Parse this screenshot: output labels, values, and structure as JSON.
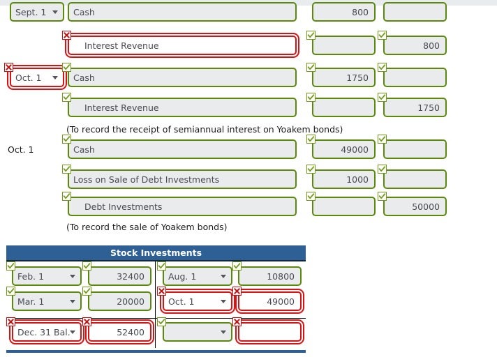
{
  "journal": {
    "rows": [
      {
        "date": "Sept. 1",
        "date_state": "ok",
        "date_marker": "none",
        "account": "Cash",
        "account_state": "ok",
        "account_marker": "none",
        "account_indent": false,
        "debit": "800",
        "debit_state": "ok",
        "debit_marker": "none",
        "credit": "",
        "credit_state": "ok",
        "credit_marker": "none"
      },
      {
        "date": "",
        "date_state": "none",
        "date_marker": "none",
        "account": "Interest Revenue",
        "account_state": "bad",
        "account_marker": "bad",
        "account_indent": true,
        "debit": "",
        "debit_state": "ok",
        "debit_marker": "ok",
        "credit": "800",
        "credit_state": "ok",
        "credit_marker": "ok"
      },
      {
        "date": "Oct. 1",
        "date_state": "bad",
        "date_marker": "bad",
        "account": "Cash",
        "account_state": "ok",
        "account_marker": "ok",
        "account_indent": false,
        "debit": "1750",
        "debit_state": "ok",
        "debit_marker": "ok",
        "credit": "",
        "credit_state": "ok",
        "credit_marker": "ok"
      },
      {
        "date": "",
        "date_state": "none",
        "date_marker": "none",
        "account": "Interest Revenue",
        "account_state": "ok",
        "account_marker": "ok",
        "account_indent": true,
        "debit": "",
        "debit_state": "ok",
        "debit_marker": "ok",
        "credit": "1750",
        "credit_state": "ok",
        "credit_marker": "ok"
      }
    ],
    "memo1": "(To record the receipt of semiannual interest on Yoakem bonds)",
    "date_label_2": "Oct. 1",
    "rows2": [
      {
        "account": "Cash",
        "account_state": "ok",
        "account_marker": "ok",
        "account_indent": false,
        "debit": "49000",
        "debit_state": "ok",
        "debit_marker": "ok",
        "credit": "",
        "credit_state": "ok",
        "credit_marker": "ok"
      },
      {
        "account": "Loss on Sale of Debt Investments",
        "account_state": "ok",
        "account_marker": "ok",
        "account_indent": false,
        "debit": "1000",
        "debit_state": "ok",
        "debit_marker": "ok",
        "credit": "",
        "credit_state": "ok",
        "credit_marker": "ok"
      },
      {
        "account": "Debt Investments",
        "account_state": "ok",
        "account_marker": "ok",
        "account_indent": true,
        "debit": "",
        "debit_state": "ok",
        "debit_marker": "ok",
        "credit": "50000",
        "credit_state": "ok",
        "credit_marker": "ok"
      }
    ],
    "memo2": "(To record the sale of Yoakem bonds)"
  },
  "stock_account": {
    "title": "Stock Investments",
    "cells": [
      {
        "id": "r1c1",
        "value": "Feb. 1",
        "type": "select",
        "state": "ok",
        "marker": "ok"
      },
      {
        "id": "r1c2",
        "value": "32400",
        "type": "number",
        "state": "ok",
        "marker": "ok"
      },
      {
        "id": "r1c3",
        "value": "Aug. 1",
        "type": "select",
        "state": "ok",
        "marker": "ok"
      },
      {
        "id": "r1c4",
        "value": "10800",
        "type": "number",
        "state": "ok",
        "marker": "ok"
      },
      {
        "id": "r2c1",
        "value": "Mar. 1",
        "type": "select",
        "state": "ok",
        "marker": "ok"
      },
      {
        "id": "r2c2",
        "value": "20000",
        "type": "number",
        "state": "ok",
        "marker": "ok"
      },
      {
        "id": "r2c3",
        "value": "Oct. 1",
        "type": "select",
        "state": "bad",
        "marker": "bad"
      },
      {
        "id": "r2c4",
        "value": "49000",
        "type": "number",
        "state": "bad",
        "marker": "bad"
      },
      {
        "id": "r3c1",
        "value": "Dec. 31 Bal.",
        "type": "select",
        "state": "bad",
        "marker": "bad"
      },
      {
        "id": "r3c2",
        "value": "52400",
        "type": "number",
        "state": "bad",
        "marker": "bad"
      },
      {
        "id": "r3c3",
        "value": "",
        "type": "select",
        "state": "ok",
        "marker": "ok"
      },
      {
        "id": "r3c4",
        "value": "",
        "type": "number",
        "state": "bad",
        "marker": "bad"
      }
    ]
  },
  "colors": {
    "correct_green": "#5b8a0a",
    "incorrect_red": "#e01010",
    "header_blue": "#2e6096",
    "field_bg": "#e9ebec",
    "text": "#4a4a52"
  }
}
